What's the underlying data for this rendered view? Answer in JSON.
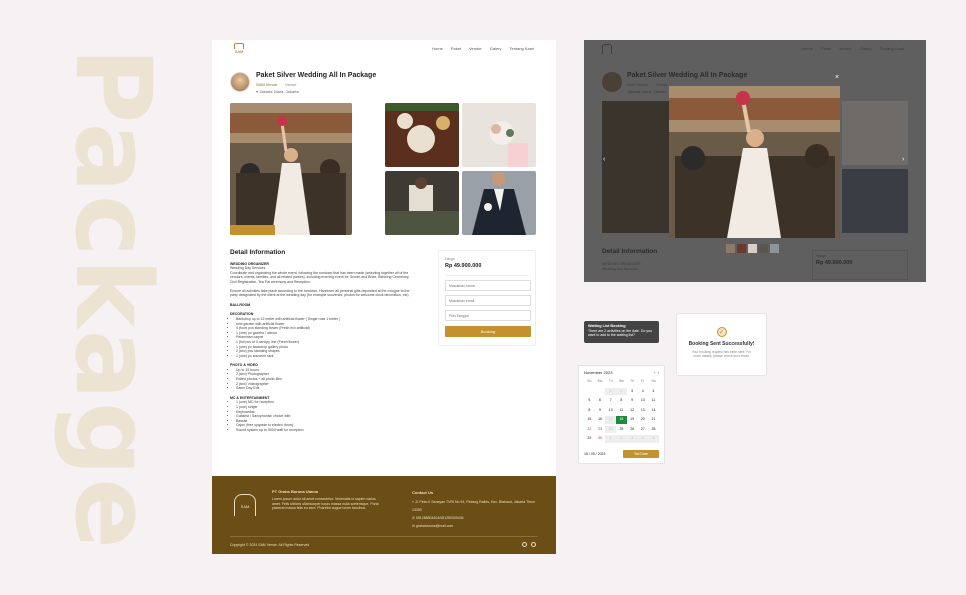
{
  "bg_word": "Package",
  "page": {
    "logo": "SAM",
    "nav": [
      "Home",
      "Paket",
      "Vendor",
      "Galery",
      "Tentang Kami"
    ],
    "title": "Paket Silver Wedding All In Package",
    "vendor": "SAM Venue",
    "vendor_type": "Venue",
    "location": "Jakarta Utara, Jakarta",
    "detail": {
      "heading": "Detail Information",
      "wo_title": "WEDDING ORGANIZER",
      "wo_sub": "Wedding Day Services",
      "wo_text": "Coordinate and organizing the whole event, following the rundown that has been made (selecting together all of the vendors, clients, families, and all related parties), including morning event for Groom and Bride, Blessing Ceremony, Civil Registration, Tea Pai ceremony and Reception.",
      "wo_text2": "Ensure all activities take place according to the rundown. Handover all personal gifts deposited at the cologne to the party designated by the client at the wedding day (for example souvenirs, photos for welcome clock decoration, etc)",
      "ballroom": "BALLROOM",
      "decoration_title": "DECORATION",
      "decoration": [
        "Backdrop up to 12 meter with artificial flower ( Single rose 1 meter )",
        "mini garden with artificial flower",
        "4 (four) pcs standing flower (Fresh mix artificial)",
        "1 (one) pc gazebo / arbour",
        "Pelaminan carpet",
        "1 (full pcs of 4 canopy line (Fresh flower)",
        "1 (one) pc backdrop gallery photo",
        "2 (two) pcs standing shapes",
        "1 (one) pc souvenir rack"
      ],
      "photo_title": "PHOTO & VIDEO",
      "photo": [
        "Up to 10 hours",
        "2 (two) Photographer",
        "Edited photos + all photo files",
        "2 (two) Videographer",
        "Same Day Edit"
      ],
      "mc_title": "MC & ENTERTAINMENT",
      "mc": [
        "1 (one) MC for reception",
        "1 (one) singer",
        "Keyboardist",
        "Guitarist / Saxophonist/ choice with",
        "Bassist",
        "Cajon (free upgrade to electric drum)",
        "Sound system up to 5000 watt for reception"
      ]
    },
    "booking": {
      "price_label": "Harga",
      "price": "Rp 49.900.000",
      "name_ph": "Masukkan nama",
      "email_ph": "Masukkan email",
      "date_ph": "Pilih Tanggal",
      "button": "Booking"
    },
    "footer": {
      "logo": "SAM",
      "company": "PT Graha Baruna Utama",
      "about": "Lorem ipsum dolor sit amet consectetur. Venenatis in sapien varius amet. Felis ultrices ullamcorper turpis massa nulla scelerisque. Porta placerat massa felis eu sem. Pharetra augue lorem faucibus.",
      "contact_title": "Contact Us",
      "address": "Jl. Pintu II Senayan TVRI No 94, Pintang Raflés, Kec. Blakraut, Jakarta Timur 13350",
      "phone": "081288804404/081250309434",
      "email": "grahabaruna@mail.com",
      "copyright": "Copyright © 2024 SAM Venue. All Rights Reserved"
    }
  },
  "dark": {
    "title": "Paket Silver Wedding All In Package",
    "vendor": "SAM Venue",
    "vendor_type": "Venue",
    "location": "Jakarta Utara, Jakarta",
    "close": "×",
    "detail": "Detail Information",
    "wo": "WEDDING ORGANIZER",
    "wo_sub": "Wedding Day Services",
    "price_label": "Harga",
    "price": "Rp 49.900.000",
    "prev": "‹",
    "next": "›"
  },
  "tooltip": {
    "title": "Waiting List Booking",
    "text": "There are 2 activities on the date. Do you want to add to the waiting list?"
  },
  "success": {
    "title": "Booking Sent Successfully!",
    "text": "Your booking request has been sent. For more details, please check your email."
  },
  "calendar": {
    "month": "November 2023",
    "dow": [
      "Su",
      "Mo",
      "Tu",
      "We",
      "Th",
      "Fr",
      "Sa"
    ],
    "days": [
      "",
      "",
      "1",
      "2",
      "3",
      "4",
      "",
      "",
      "",
      "",
      "",
      "",
      "",
      "",
      "",
      "",
      "",
      "",
      "",
      "",
      "",
      "",
      "",
      "",
      "",
      "",
      "",
      "",
      "",
      "",
      "",
      "",
      "",
      "",
      "",
      "",
      "",
      "",
      "",
      "",
      "",
      ""
    ],
    "selected_date": "18 / 09 / 2023",
    "button": "Set Date"
  },
  "colors": {
    "accent": "#c3922e",
    "footer": "#6b4e16",
    "selected": "#1e8a3c"
  }
}
